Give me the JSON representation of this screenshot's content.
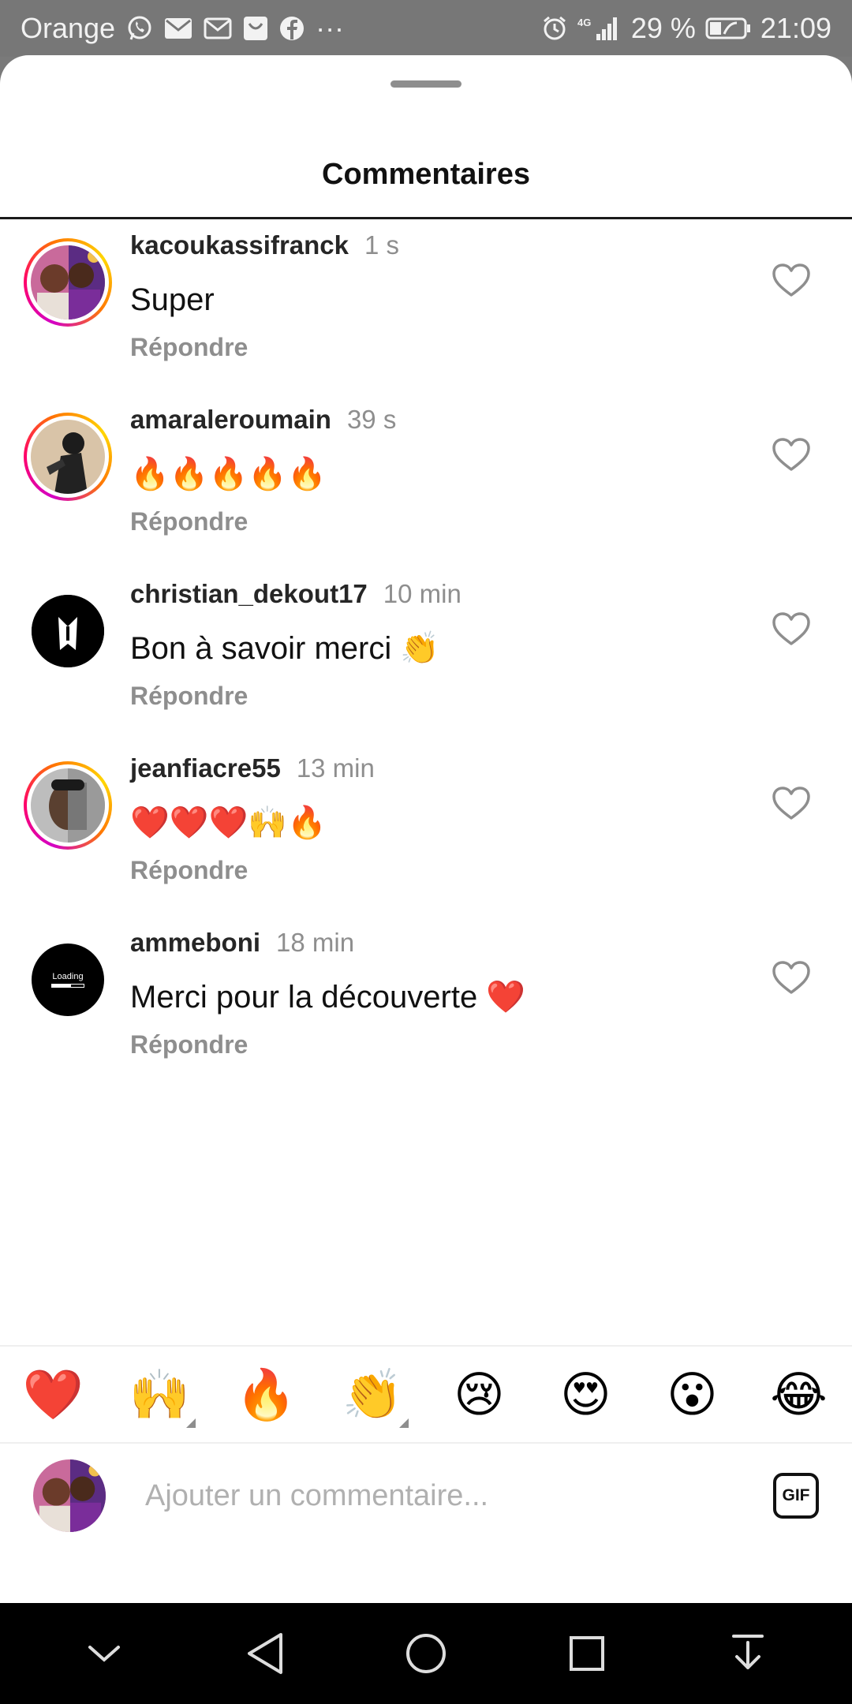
{
  "status_bar": {
    "carrier": "Orange",
    "notification_icons": [
      "whatsapp-icon",
      "mail-icon",
      "gmail-icon",
      "inbox-icon",
      "facebook-icon"
    ],
    "more": "···",
    "network": "4G",
    "battery_percent": "29 %",
    "time": "21:09"
  },
  "sheet": {
    "title": "Commentaires"
  },
  "comments": [
    {
      "username": "kacoukassifranck",
      "time": "1 s",
      "text": "Super",
      "reply_label": "Répondre",
      "avatar": "profile-photo",
      "story_ring": true
    },
    {
      "username": "amaraleroumain",
      "time": "39 s",
      "text": "🔥🔥🔥🔥🔥",
      "reply_label": "Répondre",
      "avatar": "profile-photo",
      "story_ring": true
    },
    {
      "username": "christian_dekout17",
      "time": "10 min",
      "text": "Bon à savoir merci 👏",
      "reply_label": "Répondre",
      "avatar": "tuxedo-logo",
      "story_ring": false
    },
    {
      "username": "jeanfiacre55",
      "time": "13 min",
      "text": "❤️❤️❤️🙌🔥",
      "reply_label": "Répondre",
      "avatar": "profile-photo",
      "story_ring": true
    },
    {
      "username": "ammeboni",
      "time": "18 min",
      "text": "Merci pour la découverte ❤️",
      "reply_label": "Répondre",
      "avatar": "loading-logo",
      "avatar_text": "Loading",
      "story_ring": false
    }
  ],
  "emoji_bar": [
    "❤️",
    "🙌",
    "🔥",
    "👏",
    "😢",
    "😍",
    "😮",
    "😂"
  ],
  "composer": {
    "placeholder": "Ajouter un commentaire...",
    "gif_label": "GIF"
  },
  "colors": {
    "accent_ring_start": "#d300c5",
    "accent_ring_end": "#ffd600",
    "secondary_text": "#8e8e8e"
  }
}
